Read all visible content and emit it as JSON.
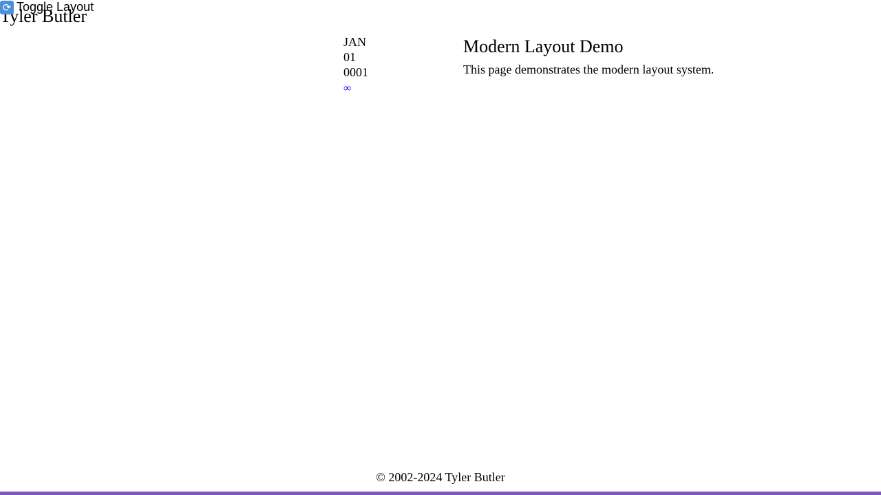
{
  "header": {
    "site_title": "Tyler Butler",
    "toggle_label": "Toggle Layout",
    "toggle_icon": "refresh-icon"
  },
  "post": {
    "date": {
      "month": "JAN",
      "day": "01",
      "year": "0001"
    },
    "permalink_symbol": "∞",
    "title": "Modern Layout Demo",
    "body": "This page demonstrates the modern layout system."
  },
  "footer": {
    "copyright": "© 2002-2024 Tyler Butler"
  },
  "colors": {
    "link": "#0000ee",
    "bottom_bar": "#7e57c2",
    "toggle_icon_bg": "#4a90d9"
  }
}
